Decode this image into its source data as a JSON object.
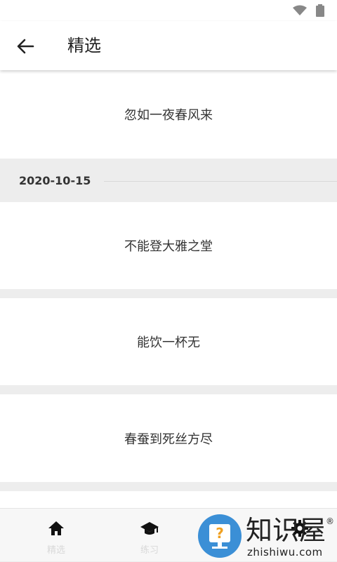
{
  "app_bar": {
    "title": "精选"
  },
  "cards": [
    {
      "text": "忽如一夜春风来"
    },
    {
      "text": "不能登大雅之堂"
    },
    {
      "text": "能饮一杯无"
    },
    {
      "text": "春蚕到死丝方尽"
    }
  ],
  "date_header": {
    "date": "2020-10-15"
  },
  "bottom_nav": {
    "items": [
      {
        "label": "精选",
        "icon": "home-icon"
      },
      {
        "label": "练习",
        "icon": "graduation-cap-icon"
      },
      {
        "label": "",
        "icon": ""
      },
      {
        "label": "",
        "icon": "gear-icon"
      }
    ]
  },
  "watermark": {
    "brand_cn": "知识屋",
    "brand_en": "zhishiwu.com",
    "reg": "®"
  },
  "colors": {
    "background": "#ededed",
    "card": "#ffffff",
    "watermark_badge": "#3b8fd6"
  }
}
